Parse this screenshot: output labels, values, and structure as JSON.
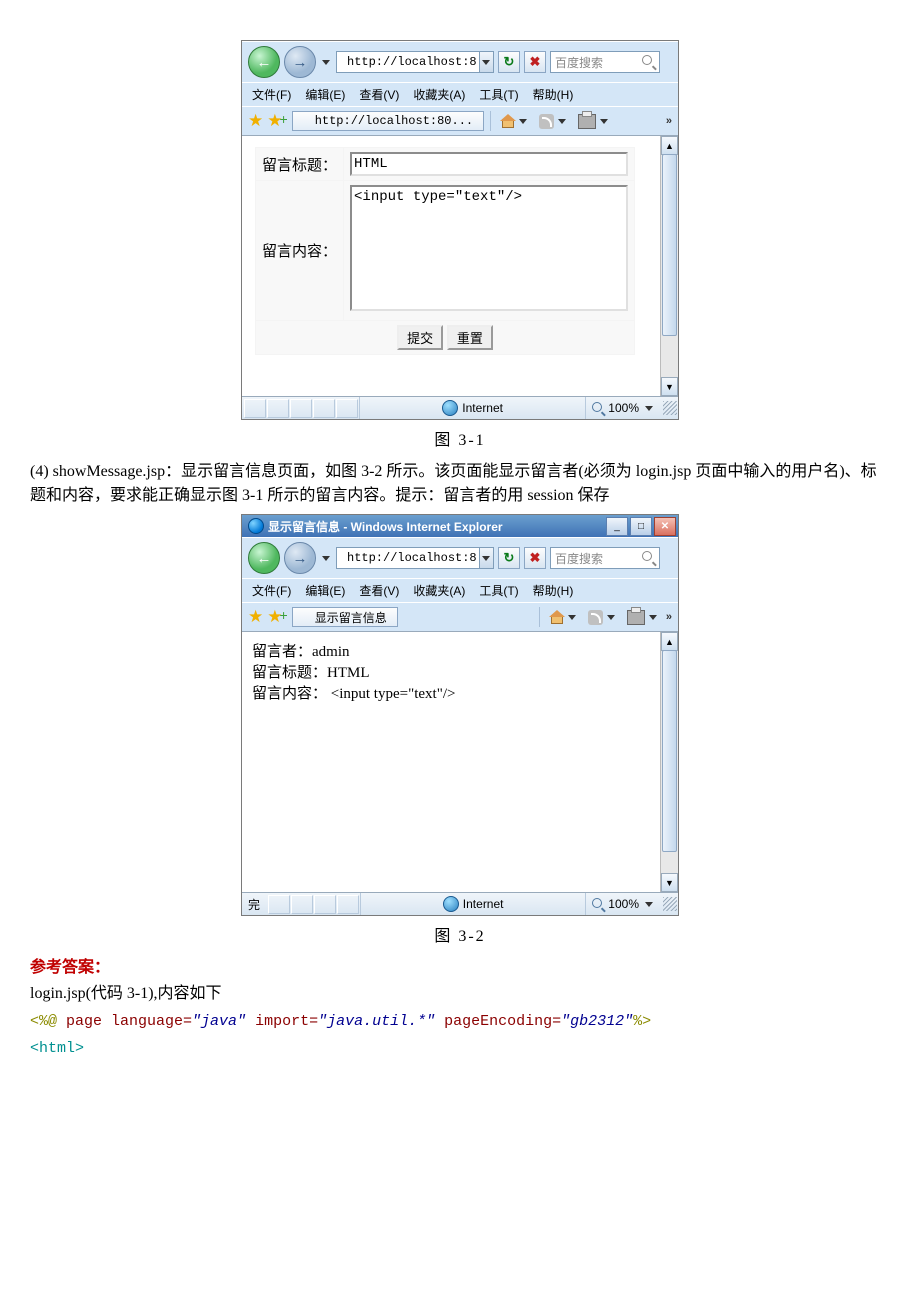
{
  "fig31": {
    "caption": "图 3-1",
    "address_url": "http://localhost:8",
    "search_placeholder": "百度搜索",
    "menu": {
      "file": "文件(F)",
      "edit": "编辑(E)",
      "view": "查看(V)",
      "fav": "收藏夹(A)",
      "tool": "工具(T)",
      "help": "帮助(H)"
    },
    "tab_label": "http://localhost:80...",
    "form": {
      "title_label": "留言标题：",
      "title_value": "HTML",
      "content_label": "留言内容：",
      "content_value": "<input type=\"text\"/>",
      "submit": "提交",
      "reset": "重置"
    },
    "status": {
      "zone": "Internet",
      "zoom": "100%"
    }
  },
  "paragraph": "(4) showMessage.jsp：显示留言信息页面，如图 3-2 所示。该页面能显示留言者(必须为 login.jsp 页面中输入的用户名)、标题和内容，要求能正确显示图 3-1 所示的留言内容。提示：留言者的用 session 保存",
  "fig32": {
    "caption": "图 3-2",
    "window_title": "显示留言信息 - Windows Internet Explorer",
    "address_url": "http://localhost:8",
    "search_placeholder": "百度搜索",
    "menu": {
      "file": "文件(F)",
      "edit": "编辑(E)",
      "view": "查看(V)",
      "fav": "收藏夹(A)",
      "tool": "工具(T)",
      "help": "帮助(H)"
    },
    "tab_label": "显示留言信息",
    "content": {
      "line1": "留言者：admin",
      "line2": "留言标题：HTML",
      "line3": "留言内容： <input type=\"text\"/>"
    },
    "status": {
      "done": "完",
      "zone": "Internet",
      "zoom": "100%"
    }
  },
  "answer_head": "参考答案：",
  "answer_sub": "login.jsp(代码 3-1),内容如下",
  "code": {
    "l1a": "<%@ ",
    "l1b": "page ",
    "l1c": "language=",
    "l1d": "\"java\"",
    "l1e": " import=",
    "l1f": "\"java.util.*\"",
    "l1g": " pageEncoding=",
    "l1h": "\"gb2312\"",
    "l1i": "%>",
    "l2": "<html>"
  }
}
